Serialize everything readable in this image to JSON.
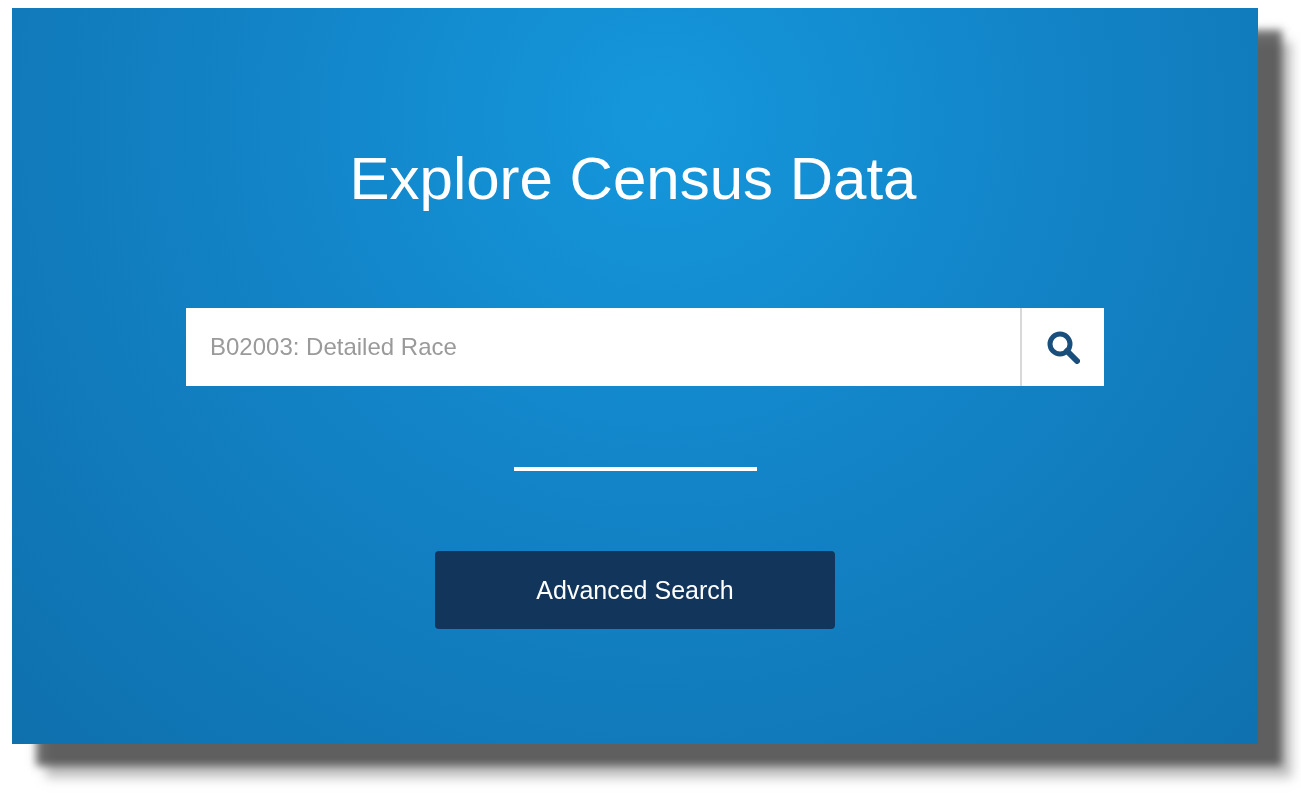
{
  "title": "Explore Census Data",
  "search": {
    "placeholder": "B02003: Detailed Race"
  },
  "advanced_button": {
    "label": "Advanced Search"
  }
}
